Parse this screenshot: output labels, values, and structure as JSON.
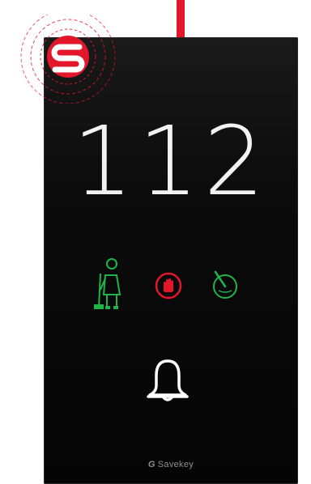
{
  "device": {
    "room_number": "112",
    "brand": {
      "mark": "G",
      "name": "Savekey"
    },
    "status_icons": [
      {
        "name": "housekeeping-icon",
        "color": "#1fb34a"
      },
      {
        "name": "do-not-disturb-icon",
        "color": "#e3172b"
      },
      {
        "name": "valet-icon",
        "color": "#1fb34a"
      }
    ],
    "doorbell": {
      "icon": "bell-icon",
      "color": "#ffffff"
    },
    "logo": {
      "icon": "s-logo-icon",
      "color": "#e3172b"
    },
    "accent_color": "#e3172b"
  }
}
